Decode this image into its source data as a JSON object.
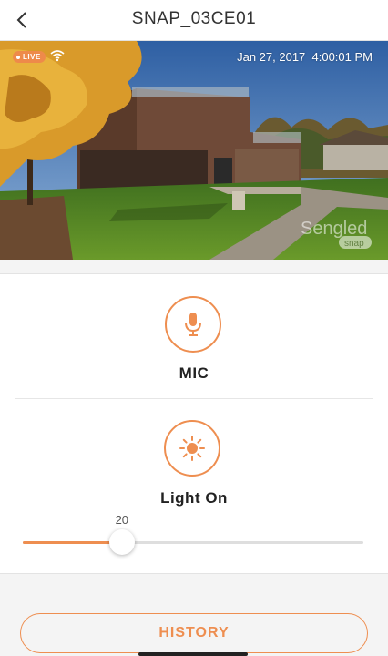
{
  "header": {
    "title": "SNAP_03CE01",
    "back_icon": "chevron-left-icon"
  },
  "video": {
    "live_label": "LIVE",
    "timestamp": "Jan 27, 2017  4:00:01 PM",
    "watermark_brand": "Sengled",
    "watermark_product": "snap",
    "wifi_icon": "wifi-icon"
  },
  "controls": {
    "mic_label": "MIC",
    "mic_icon": "microphone-icon",
    "light_label": "Light On",
    "light_icon": "sun-icon",
    "brightness": {
      "value": 20,
      "min": 0,
      "max": 100,
      "value_label": "20"
    }
  },
  "history": {
    "label": "HISTORY"
  },
  "colors": {
    "accent": "#ee8e50",
    "live_badge": "#ee8a4a"
  }
}
